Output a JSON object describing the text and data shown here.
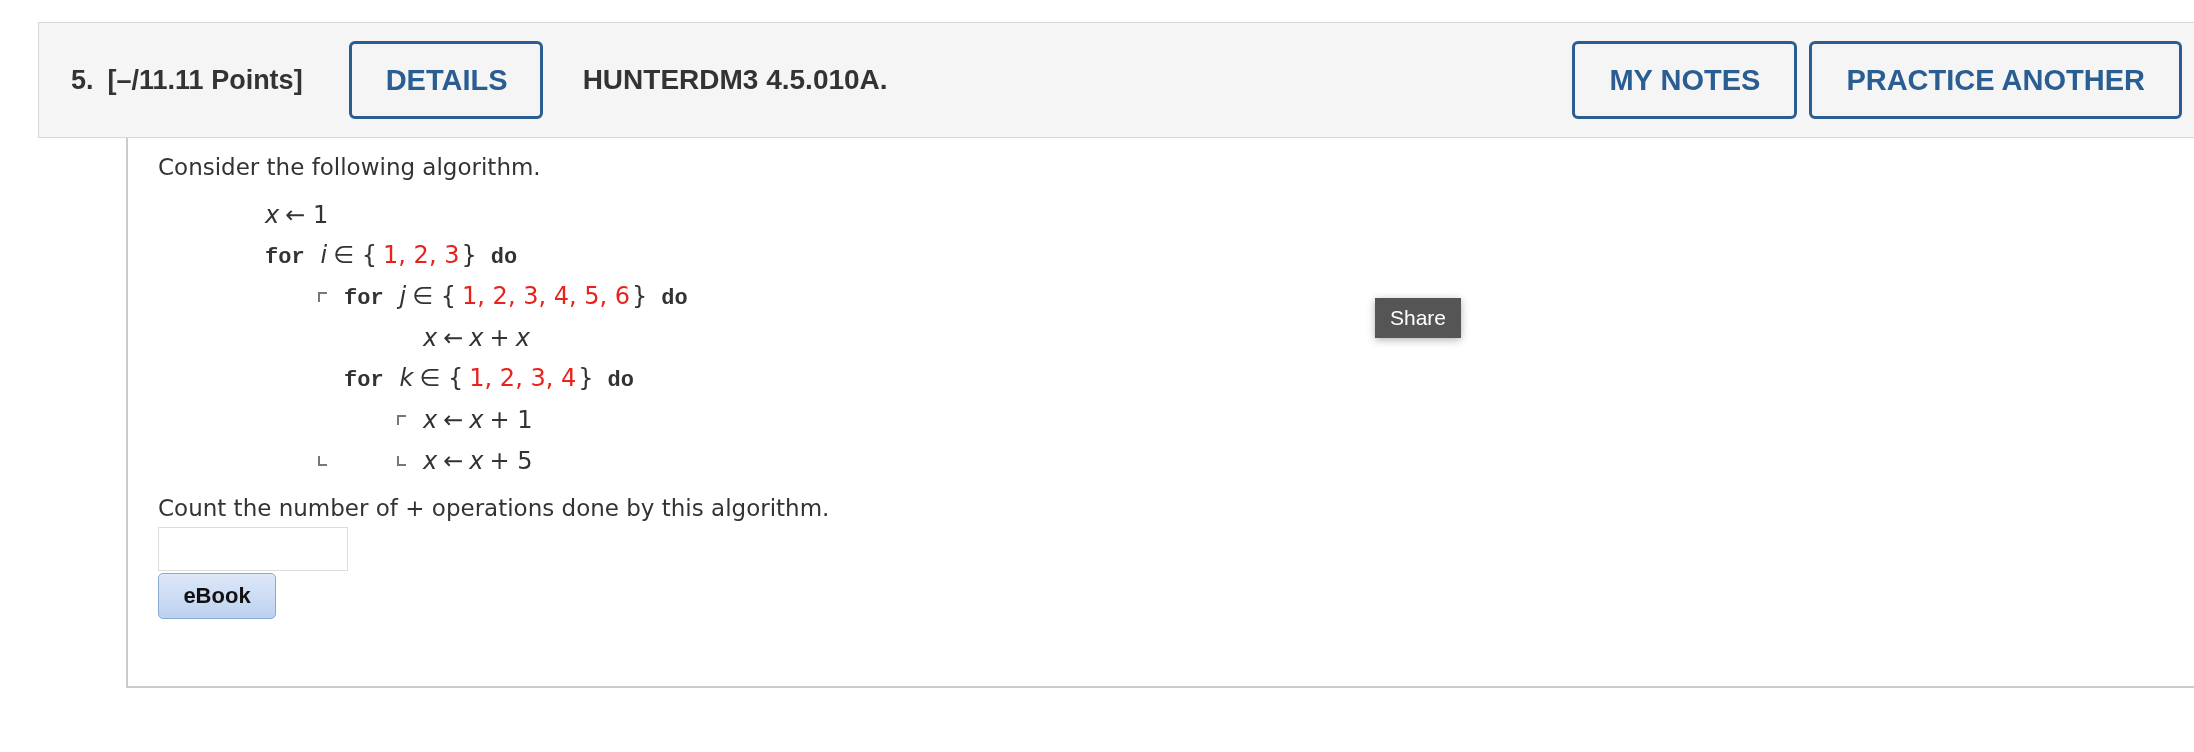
{
  "question": {
    "number": "5.",
    "points": "[–/11.11 Points]",
    "details_button": "DETAILS",
    "code": "HUNTERDM3 4.5.010A.",
    "buttons": [
      "MY NOTES",
      "PRACTICE ANOTHER"
    ]
  },
  "prompt": "Consider the following algorithm.",
  "algorithm": [
    {
      "parts": [
        {
          "kind": "var",
          "text": "x"
        },
        {
          "kind": "op",
          "text": "← 1"
        }
      ]
    },
    {
      "parts": [
        {
          "kind": "keyword",
          "text": "for"
        },
        {
          "kind": "var",
          "text": "i"
        },
        {
          "kind": "op",
          "text": "∈ {"
        },
        {
          "kind": "num",
          "text": "1, 2, 3"
        },
        {
          "kind": "op",
          "text": "}"
        },
        {
          "kind": "keyword",
          "text": "do"
        }
      ],
      "children": [
        {
          "parts": [
            {
              "kind": "keyword",
              "text": "for"
            },
            {
              "kind": "var",
              "text": "j"
            },
            {
              "kind": "op",
              "text": "∈ {"
            },
            {
              "kind": "num",
              "text": "1, 2, 3, 4, 5, 6"
            },
            {
              "kind": "op",
              "text": "}"
            },
            {
              "kind": "keyword",
              "text": "do"
            }
          ],
          "children": [
            {
              "parts": [
                {
                  "kind": "var",
                  "text": "x"
                },
                {
                  "kind": "op",
                  "text": "←"
                },
                {
                  "kind": "var",
                  "text": "x"
                },
                {
                  "kind": "op",
                  "text": "+"
                },
                {
                  "kind": "var",
                  "text": "x"
                }
              ]
            }
          ]
        },
        {
          "parts": [
            {
              "kind": "keyword",
              "text": "for"
            },
            {
              "kind": "var",
              "text": "k"
            },
            {
              "kind": "op",
              "text": "∈ {"
            },
            {
              "kind": "num",
              "text": "1, 2, 3, 4"
            },
            {
              "kind": "op",
              "text": "}"
            },
            {
              "kind": "keyword",
              "text": "do"
            }
          ],
          "children": [
            {
              "parts": [
                {
                  "kind": "var",
                  "text": "x"
                },
                {
                  "kind": "op",
                  "text": "←"
                },
                {
                  "kind": "var",
                  "text": "x"
                },
                {
                  "kind": "op",
                  "text": "+ 1"
                }
              ]
            },
            {
              "parts": [
                {
                  "kind": "var",
                  "text": "x"
                },
                {
                  "kind": "op",
                  "text": "←"
                },
                {
                  "kind": "var",
                  "text": "x"
                },
                {
                  "kind": "op",
                  "text": "+ 5"
                }
              ]
            }
          ]
        }
      ]
    }
  ],
  "question_text": "Count the number of + operations done by this algorithm.",
  "ebook_button": "eBook",
  "tooltip": "Share"
}
